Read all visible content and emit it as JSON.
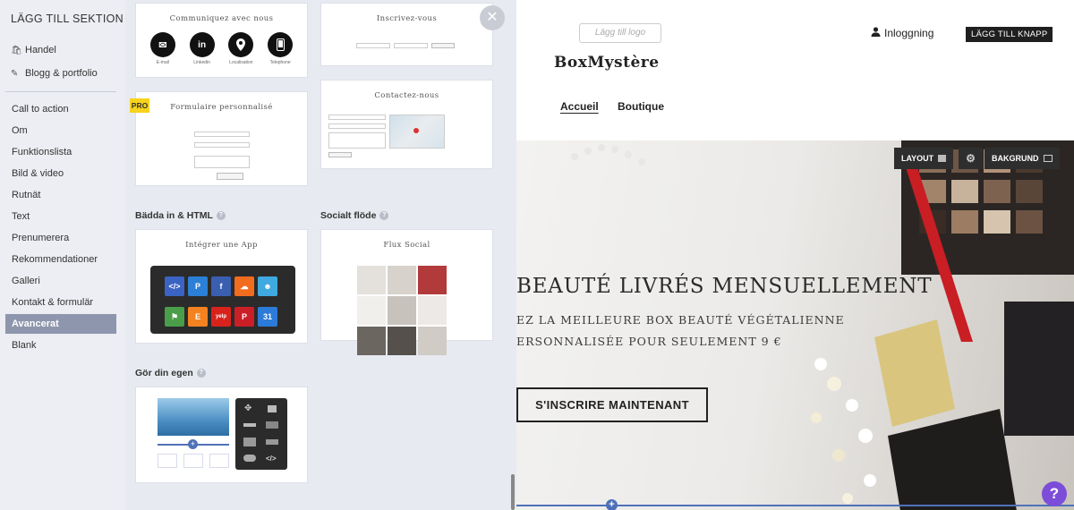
{
  "sidebar": {
    "title": "LÄGG TILL SEKTION",
    "top_items": [
      {
        "label": "Handel",
        "icon": "shopping-bag-icon"
      },
      {
        "label": "Blogg & portfolio",
        "icon": "edit-icon"
      }
    ],
    "items": [
      {
        "label": "Call to action"
      },
      {
        "label": "Om"
      },
      {
        "label": "Funktionslista"
      },
      {
        "label": "Bild & video"
      },
      {
        "label": "Rutnät"
      },
      {
        "label": "Text"
      },
      {
        "label": "Prenumerera"
      },
      {
        "label": "Rekommendationer"
      },
      {
        "label": "Galleri"
      },
      {
        "label": "Kontakt & formulär"
      },
      {
        "label": "Avancerat",
        "active": true
      },
      {
        "label": "Blank"
      }
    ]
  },
  "panel": {
    "cards": {
      "communiquez": {
        "title": "Communiquez avec nous",
        "icons": [
          {
            "label": "E-mail",
            "icon": "email-icon"
          },
          {
            "label": "Linkedin",
            "icon": "linkedin-icon"
          },
          {
            "label": "Localisation",
            "icon": "location-pin-icon"
          },
          {
            "label": "Telephone",
            "icon": "phone-icon"
          }
        ]
      },
      "inscrivez": {
        "title": "Inscrivez-vous"
      },
      "formulaire": {
        "title": "Formulaire personnalisé",
        "badge": "PRO"
      },
      "contactez": {
        "title": "Contactez-nous"
      },
      "integrer": {
        "title": "Intégrer une App"
      },
      "flux": {
        "title": "Flux Social"
      }
    },
    "sections": {
      "embed_label": "Bädda in & HTML",
      "social_label": "Socialt flöde",
      "custom_label": "Gör din egen"
    },
    "close_icon": "close-icon"
  },
  "site": {
    "logo_placeholder": "Lägg till logo",
    "brand": "BoxMystère",
    "login_label": "Inloggning",
    "add_button_label": "LÄGG TILL KNAPP",
    "nav": [
      {
        "label": "Accueil",
        "active": true
      },
      {
        "label": "Boutique"
      }
    ],
    "toolbar": {
      "layout_label": "LAYOUT",
      "background_label": "BAKGRUND"
    },
    "hero": {
      "headline": "BEAUTÉ LIVRÉS MENSUELLEMENT",
      "sub1": "EZ LA MEILLEURE BOX BEAUTÉ VÉGÉTALIENNE",
      "sub2": "ERSONNALISÉE POUR SEULEMENT 9 €",
      "cta_label": "S'INSCRIRE MAINTENANT"
    },
    "help_label": "?",
    "colors": {
      "accent": "#4f71b8",
      "help": "#7c4dd8",
      "active_sidebar": "#8e96ad",
      "pro_badge": "#f7d21c"
    }
  }
}
